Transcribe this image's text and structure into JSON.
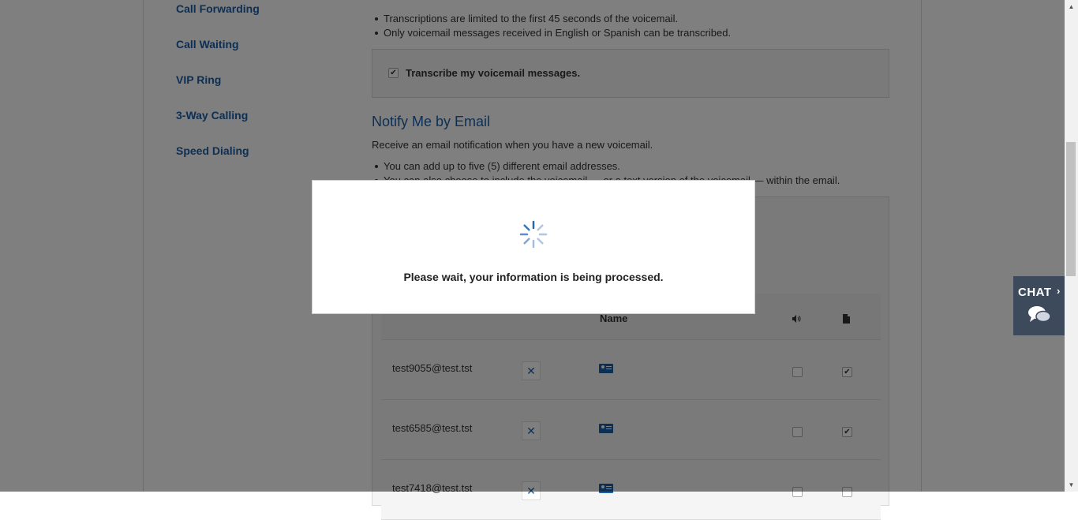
{
  "sidebar": {
    "items": [
      {
        "label": "Call Forwarding"
      },
      {
        "label": "Call Waiting"
      },
      {
        "label": "VIP Ring"
      },
      {
        "label": "3-Way Calling"
      },
      {
        "label": "Speed Dialing"
      }
    ]
  },
  "transcription": {
    "notes": [
      "Transcriptions are limited to the first 45 seconds of the voicemail.",
      "Only voicemail messages received in English or Spanish can be transcribed."
    ],
    "checkbox_label": "Transcribe my voicemail messages.",
    "checked": true
  },
  "notify": {
    "title": "Notify Me by Email",
    "description": "Receive an email notification when you have a new voicemail.",
    "notes": [
      "You can add up to five (5) different email addresses.",
      "You can also choose to include the voicemail — or a text version of the voicemail — within the email."
    ],
    "table": {
      "name_header": "Name",
      "audio_header_icon": "speaker-icon",
      "file_header_icon": "document-icon",
      "rows": [
        {
          "email": "test9055@test.tst",
          "audio": false,
          "file": true
        },
        {
          "email": "test6585@test.tst",
          "audio": false,
          "file": true
        },
        {
          "email": "test7418@test.tst",
          "audio": false,
          "file": false
        }
      ]
    }
  },
  "modal": {
    "message": "Please wait, your information is being processed.",
    "icon": "loading-spinner-icon"
  },
  "chat": {
    "label": "CHAT",
    "icon": "chat-bubble-icon"
  },
  "colors": {
    "link": "#1a5fa8",
    "overlay": "rgba(0,0,0,0.5)",
    "chat_bg": "#3d4a5c"
  }
}
